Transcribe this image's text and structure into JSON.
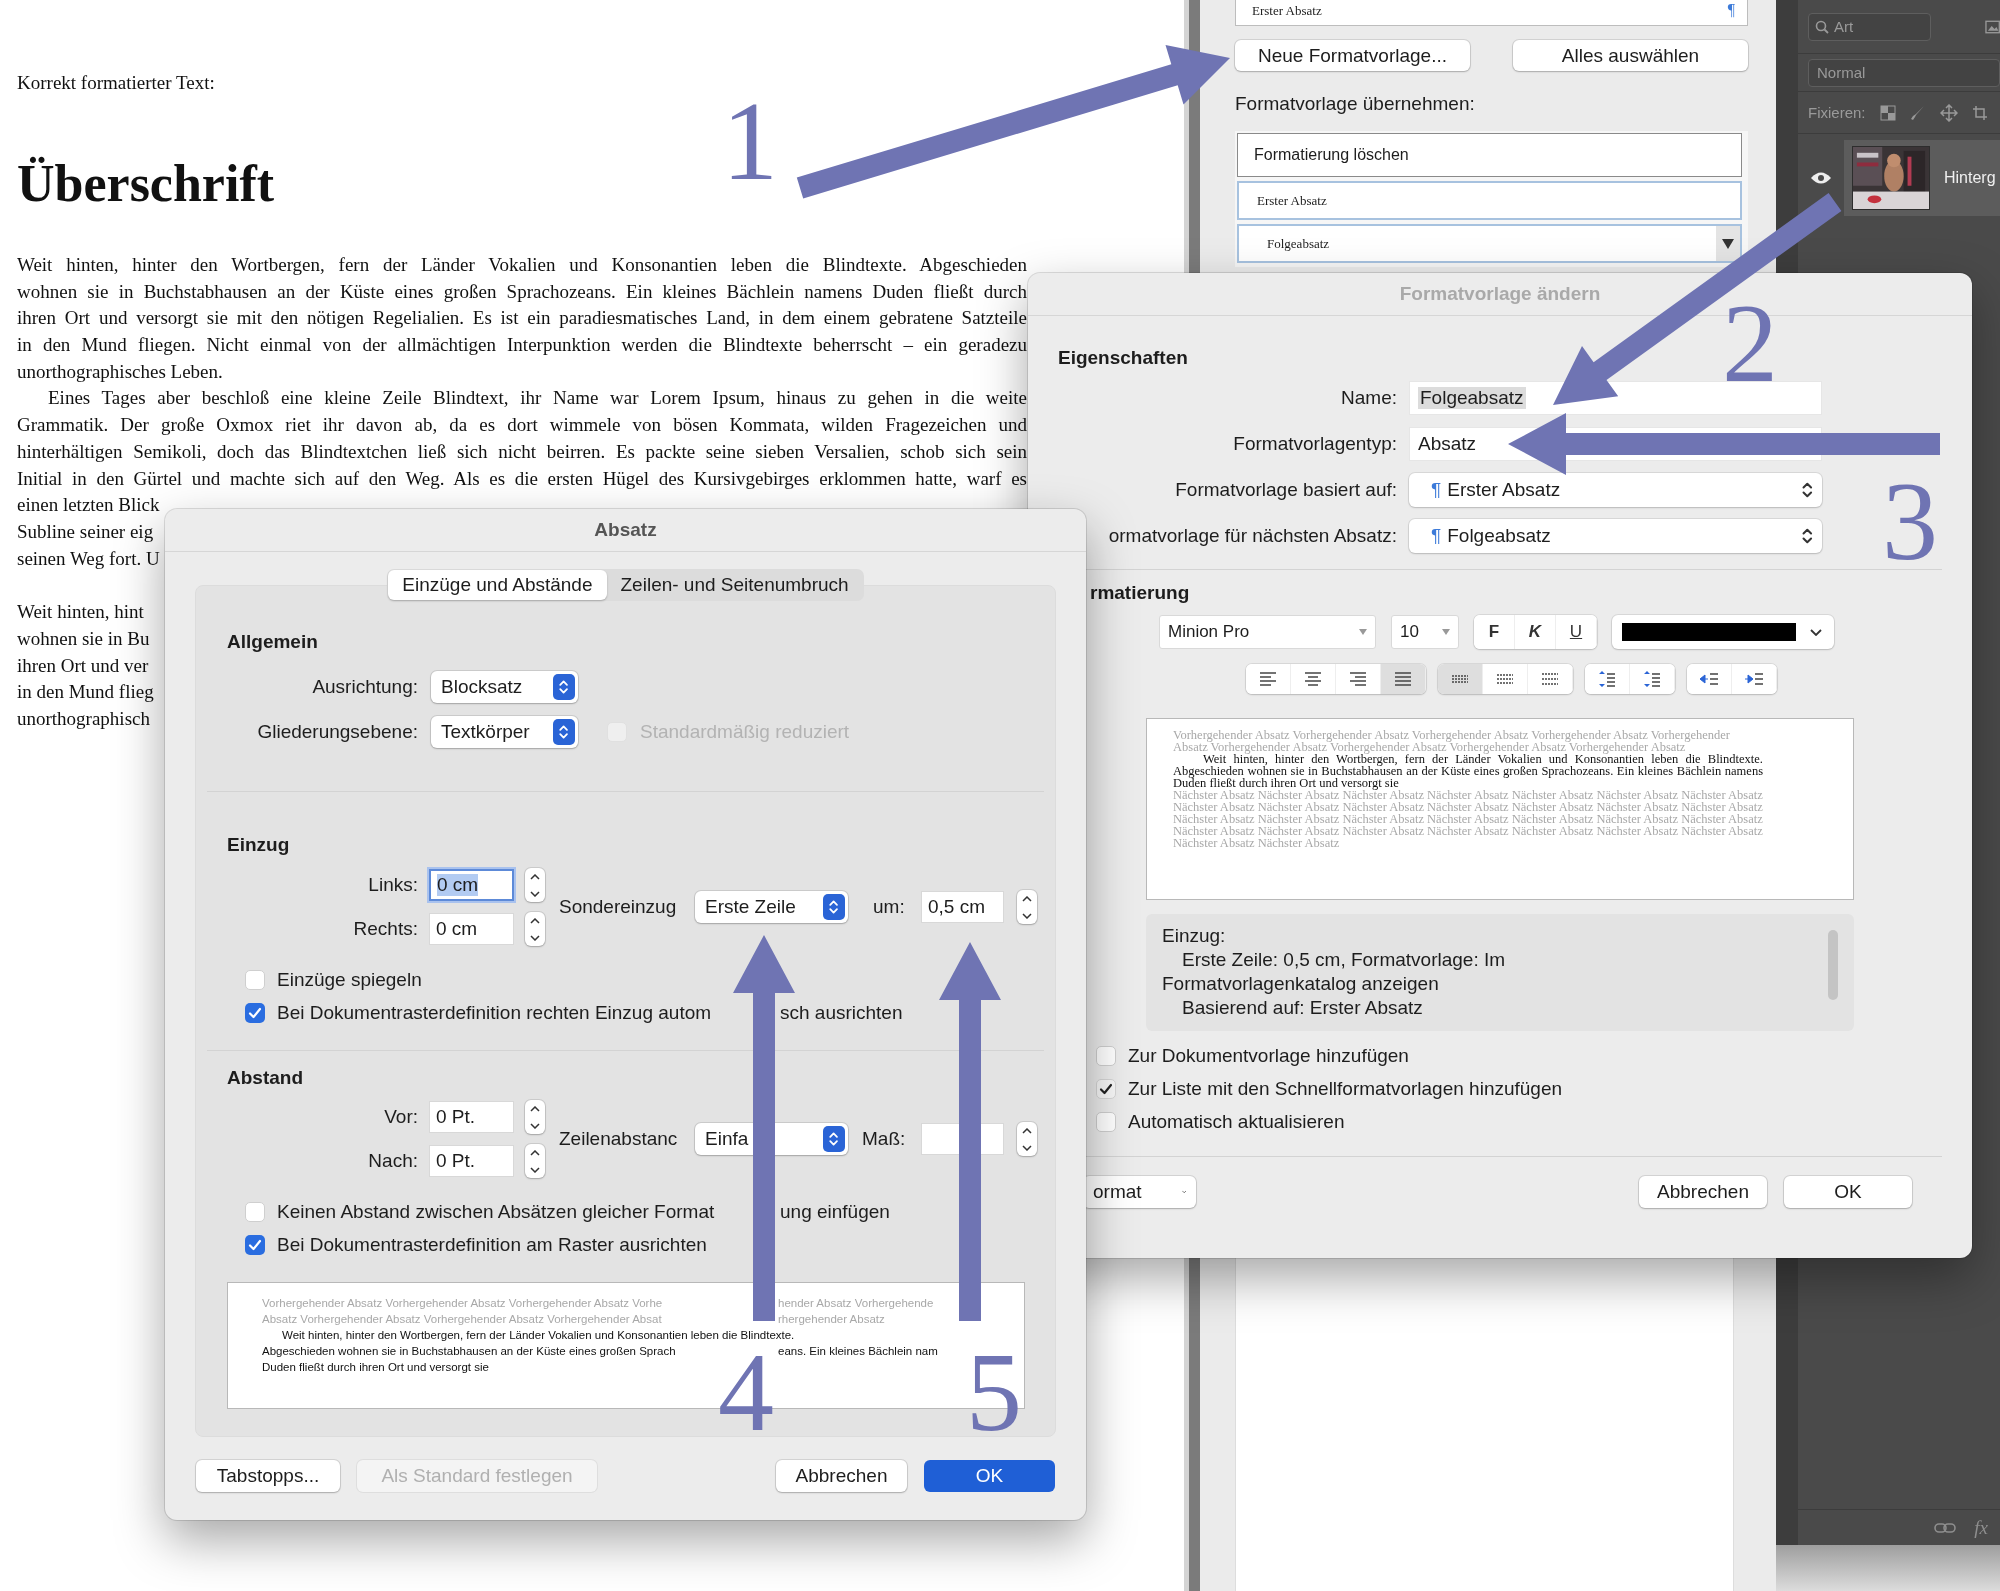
{
  "document": {
    "intro": "Korrekt formatierter Text:",
    "heading": "Überschrift",
    "blocks": [
      {
        "paragraphs": [
          {
            "indented": false,
            "lines": [
              {
                "text": "Weit hinten, hinter den Wortbergen, fern der Länder Vokalien und Konsonantien leben die Blindtexte. Abgeschieden",
                "justified": true
              },
              {
                "text": "wohnen sie in Buchstabhausen an der Küste eines großen Sprachozeans. Ein kleines Bächlein namens Duden fließt durch",
                "justified": true
              },
              {
                "text": "ihren Ort und versorgt sie mit den nötigen Regelialien. Es ist ein paradiesmatisches Land, in dem einem gebratene Satzteile",
                "justified": true
              },
              {
                "text": "in den Mund fliegen. Nicht einmal von der allmächtigen Interpunktion werden die Blindtexte beherrscht – ein geradezu",
                "justified": true
              },
              {
                "text": "unorthographisches Leben.",
                "justified": false
              }
            ]
          },
          {
            "indented": true,
            "lines": [
              {
                "text": "Eines Tages aber beschloß eine kleine Zeile Blindtext, ihr Name war Lorem Ipsum, hinaus zu gehen in die weite",
                "justified": true
              },
              {
                "text": "Grammatik. Der große Oxmox riet ihr davon ab, da es dort wimmele von bösen Kommata, wilden Fragezeichen und",
                "justified": true
              },
              {
                "text": "hinterhältigen Semikoli, doch das Blindtextchen ließ sich nicht beirren. Es packte seine sieben Versalien, schob sich sein",
                "justified": true
              },
              {
                "text": "Initial in den Gürtel und machte sich auf den Weg. Als es die ersten Hügel des Kursivgebirges erklommen hatte, warf es",
                "justified": true
              },
              {
                "text": "einen letzten Blick",
                "justified": false
              },
              {
                "text": "Subline seiner eig",
                "justified": false
              },
              {
                "text": "seinen Weg fort. U",
                "justified": false
              }
            ]
          }
        ]
      },
      {
        "paragraphs": [
          {
            "indented": false,
            "lines": [
              {
                "text": "Weit hinten, hint",
                "justified": false
              },
              {
                "text": "wohnen sie in Bu",
                "justified": false
              },
              {
                "text": "ihren Ort und ver",
                "justified": false
              },
              {
                "text": "in den Mund flieg",
                "justified": false
              },
              {
                "text": "unorthographisch",
                "justified": false
              }
            ]
          }
        ]
      }
    ]
  },
  "style_panel": {
    "current_style": "Erster Absatz",
    "mark": "¶",
    "buttons": [
      "Neue Formatvorlage...",
      "Alles auswählen"
    ],
    "apply_label": "Formatvorlage übernehmen:",
    "styles": [
      {
        "label": "Formatierung löschen",
        "kind": "clear"
      },
      {
        "label": "Erster Absatz",
        "kind": "style"
      },
      {
        "label": "Folgeabsatz",
        "kind": "dropdown"
      }
    ]
  },
  "layers_panel": {
    "search_placeholder": "Art",
    "blend_mode": "Normal",
    "lock_label": "Fixieren:",
    "layers": [
      {
        "name": "Hinterg",
        "visible": true
      }
    ],
    "footer_fx": "fx"
  },
  "style_dialog": {
    "title": "Formatvorlage ändern",
    "properties_heading": "Eigenschaften",
    "fields": [
      {
        "label": "Name:",
        "value": "Folgeabsatz",
        "kind": "text"
      },
      {
        "label": "Formatvorlagentyp:",
        "value": "Absatz",
        "kind": "plain"
      },
      {
        "label": "Formatvorlage basiert auf:",
        "value": "Erster Absatz",
        "mark": "¶",
        "kind": "popup"
      },
      {
        "label": "ormatvorlage für nächsten Absatz:",
        "value": "Folgeabsatz",
        "mark": "¶",
        "kind": "popup"
      }
    ],
    "formatting_heading": "rmatierung",
    "font": "Minion Pro",
    "size": "10",
    "text_styles": [
      {
        "label": "F",
        "kind": "bold"
      },
      {
        "label": "K",
        "kind": "italic"
      },
      {
        "label": "U",
        "kind": "underline"
      }
    ],
    "toolbar_groups": [
      {
        "buttons": [
          {
            "kind": "align-left",
            "selected": false
          },
          {
            "kind": "align-center",
            "selected": false
          },
          {
            "kind": "align-right",
            "selected": false
          },
          {
            "kind": "justify",
            "selected": true
          }
        ]
      },
      {
        "buttons": [
          {
            "kind": "single",
            "selected": true
          },
          {
            "kind": "onehalf",
            "selected": false
          },
          {
            "kind": "double",
            "selected": false
          }
        ]
      },
      {
        "buttons": [
          {
            "kind": "space-before",
            "selected": false
          },
          {
            "kind": "space-after",
            "selected": false
          }
        ]
      },
      {
        "buttons": [
          {
            "kind": "outdent",
            "selected": false
          },
          {
            "kind": "indent",
            "selected": false
          }
        ]
      }
    ],
    "preview": {
      "before": "Vorhergehender Absatz Vorhergehender Absatz Vorhergehender Absatz Vorhergehender Absatz Vorhergehender Absatz Vorhergehender Absatz Vorhergehender Absatz Vorhergehender Absatz Vorhergehender Absatz",
      "body": "Weit hinten, hinter den Wortbergen, fern der Länder Vokalien und Konsonantien leben die Blindtexte. Abgeschieden wohnen sie in Buchstabhausen an der Küste eines großen Sprachozeans. Ein kleines Bächlein namens Duden fließt durch ihren Ort und versorgt sie",
      "after": "Nächster Absatz Nächster Absatz Nächster Absatz Nächster Absatz Nächster Absatz Nächster Absatz Nächster Absatz Nächster Absatz Nächster Absatz Nächster Absatz Nächster Absatz Nächster Absatz Nächster Absatz Nächster Absatz Nächster Absatz Nächster Absatz Nächster Absatz Nächster Absatz Nächster Absatz Nächster Absatz Nächster Absatz Nächster Absatz Nächster Absatz Nächster Absatz Nächster Absatz Nächster Absatz Nächster Absatz Nächster Absatz Nächster Absatz Nächster Absatz"
    },
    "description": [
      {
        "text": "Einzug:",
        "indented": false
      },
      {
        "text": "Erste Zeile:  0,5 cm, Formatvorlage: Im",
        "indented": true
      },
      {
        "text": "Formatvorlagenkatalog anzeigen",
        "indented": false
      },
      {
        "text": "Basierend auf: Erster Absatz",
        "indented": true
      }
    ],
    "checkboxes": [
      {
        "label": "Zur Dokumentvorlage hinzufügen",
        "checked": false
      },
      {
        "label": "Zur Liste mit den Schnellformatvorlagen hinzufügen",
        "checked": true
      },
      {
        "label": "Automatisch aktualisieren",
        "checked": false
      }
    ],
    "buttons": [
      {
        "label": "ormat",
        "kind": "menu"
      },
      {
        "label": "Abbrechen",
        "kind": "normal"
      },
      {
        "label": "OK",
        "kind": "normal"
      }
    ]
  },
  "paragraph_dialog": {
    "title": "Absatz",
    "tabs": [
      {
        "label": "Einzüge und Abstände",
        "selected": true
      },
      {
        "label": "Zeilen- und Seitenumbruch",
        "selected": false
      }
    ],
    "general": {
      "heading": "Allgemein",
      "rows": [
        {
          "label": "Ausrichtung:",
          "value": "Blocksatz"
        },
        {
          "label": "Gliederungsebene:",
          "value": "Textkörper"
        }
      ],
      "collapsed": {
        "label": "Standardmäßig reduziert",
        "checked": false,
        "disabled": true
      }
    },
    "indent": {
      "heading": "Einzug",
      "fields": [
        {
          "label": "Links:",
          "value": "0 cm",
          "focused": true
        },
        {
          "label": "Rechts:",
          "value": "0 cm",
          "focused": false
        }
      ],
      "special_label": "Sondereinzug",
      "special_value": "Erste Zeile",
      "by_label": "um:",
      "by_value": "0,5 cm",
      "checkboxes": [
        {
          "segments": [
            "Einzüge spiegeln"
          ],
          "checked": false
        },
        {
          "segments": [
            "Bei Dokumentrasterdefinition rechten Einzug autom",
            "sch ausrichten"
          ],
          "checked": true
        }
      ]
    },
    "spacing": {
      "heading": "Abstand",
      "fields": [
        {
          "label": "Vor:",
          "value": "0 Pt.",
          "focused": false
        },
        {
          "label": "Nach:",
          "value": "0 Pt.",
          "focused": false
        }
      ],
      "line_label": "Zeilenabstanc",
      "line_value": "Einfa",
      "at_label": "Maß:",
      "checkboxes": [
        {
          "segments": [
            "Keinen Abstand zwischen Absätzen gleicher Format",
            "ung einfügen"
          ],
          "checked": false
        },
        {
          "segments": [
            "Bei Dokumentrasterdefinition am Raster ausrichten"
          ],
          "checked": true
        }
      ]
    },
    "preview": [
      {
        "kind": "before",
        "indented": false,
        "segments": [
          "Vorhergehender Absatz Vorhergehender Absatz Vorhergehender Absatz Vorhe",
          "hender Absatz Vorhergehende"
        ]
      },
      {
        "kind": "before",
        "indented": false,
        "segments": [
          "Absatz Vorhergehender Absatz Vorhergehender Absatz Vorhergehender Absat",
          "rhergehender Absatz"
        ]
      },
      {
        "kind": "body",
        "indented": true,
        "segments": [
          "Weit hinten, hinter den Wortbergen, fern der Länder Vokalien und Konsonantien leben die Blindtexte."
        ]
      },
      {
        "kind": "body",
        "indented": false,
        "segments": [
          "Abgeschieden wohnen sie in Buchstabhausen an der Küste eines großen Sprach",
          "eans. Ein kleines Bächlein nam"
        ]
      },
      {
        "kind": "body",
        "indented": false,
        "segments": [
          "Duden fließt durch ihren Ort und versorgt sie"
        ]
      }
    ],
    "buttons": [
      {
        "label": "Tabstopps...",
        "kind": "normal"
      },
      {
        "label": "Als Standard festlegen",
        "kind": "disabled"
      },
      {
        "label": "Abbrechen",
        "kind": "normal"
      },
      {
        "label": "OK",
        "kind": "default"
      }
    ]
  },
  "annotations": [
    {
      "number": "1"
    },
    {
      "number": "2"
    },
    {
      "number": "3"
    },
    {
      "number": "4"
    },
    {
      "number": "5"
    }
  ]
}
